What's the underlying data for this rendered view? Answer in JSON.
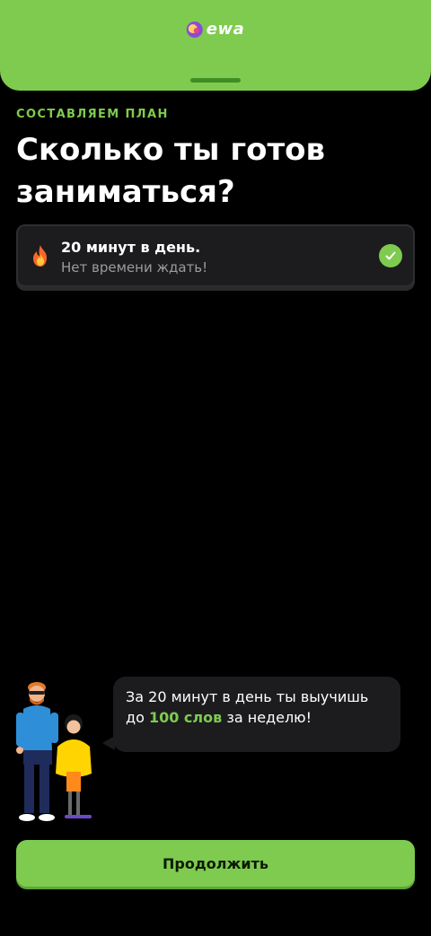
{
  "header": {
    "logo_text": "ewa",
    "logo_icon": "ewa-logo-icon",
    "background": "#7ecb4f"
  },
  "onboarding": {
    "eyebrow": "СОСТАВЛЯЕМ ПЛАН",
    "title": "Сколько ты готов заниматься?"
  },
  "selected_option": {
    "icon": "fire-icon",
    "title": "20 минут в день.",
    "subtitle": "Нет времени ждать!",
    "selected": true,
    "check_icon": "checkmark-icon"
  },
  "tip": {
    "text_before": "За 20 минут в день ты выучишь до",
    "highlight": "100 слов",
    "text_after": "за неделю!",
    "illustration": "man-and-girl-illustration"
  },
  "footer": {
    "continue_label": "Продолжить"
  },
  "colors": {
    "accent": "#7ecb4f",
    "background": "#000000",
    "card": "#1c1c1e",
    "muted_text": "#9b9ba0"
  }
}
